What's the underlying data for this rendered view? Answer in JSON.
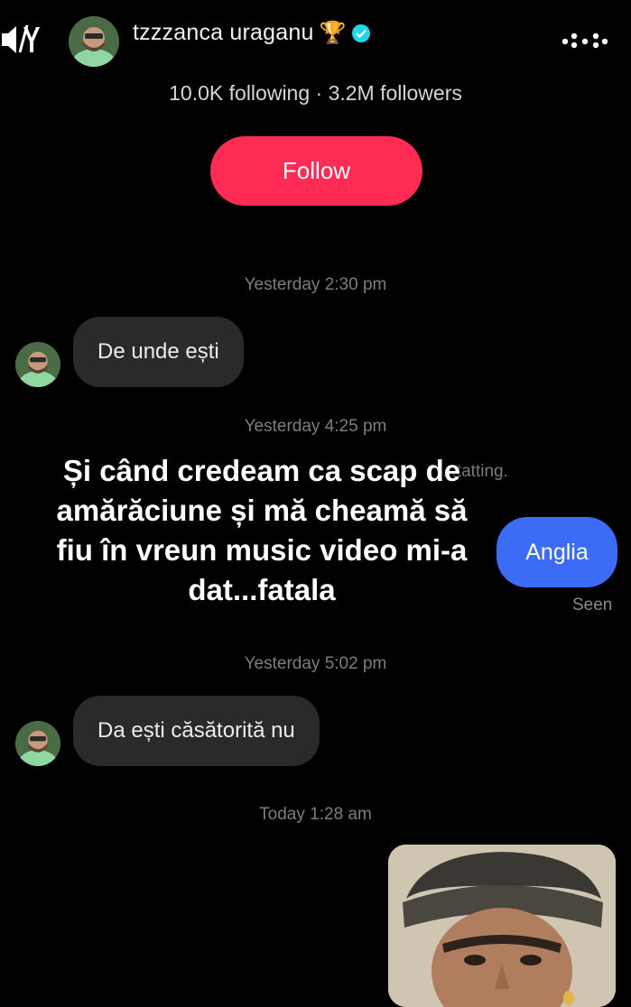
{
  "header": {
    "username": "tzzzanca uraganu",
    "trophy": "🏆",
    "stats": "10.0K following · 3.2M followers",
    "follow_label": "Follow",
    "icons": [
      "mute-icon",
      "trophy-icon",
      "verified-badge-icon",
      "more-icon"
    ]
  },
  "chat": {
    "items": [
      {
        "type": "timestamp",
        "text": "Yesterday 2:30 pm"
      },
      {
        "type": "incoming",
        "text": "De unde ești"
      },
      {
        "type": "timestamp",
        "text": "Yesterday 4:25 pm"
      },
      {
        "type": "system",
        "text": "...tatting."
      },
      {
        "type": "outgoing",
        "text": "Anglia"
      },
      {
        "type": "seen",
        "text": "Seen"
      },
      {
        "type": "timestamp",
        "text": "Yesterday 5:02 pm"
      },
      {
        "type": "incoming",
        "text": "Da ești căsătorită nu"
      },
      {
        "type": "timestamp",
        "text": "Today 1:28 am"
      }
    ]
  },
  "overlay_caption": {
    "lines": [
      "Și când credeam ca scap de",
      "amărăciune și mă cheamă să",
      "fiu în vreun music video mi-a",
      "dat...fatala"
    ]
  },
  "colors": {
    "background": "#000000",
    "follow_button": "#fe2c55",
    "outgoing_bubble": "#3c6bf6",
    "incoming_bubble": "#2a2a2a",
    "verified": "#20d5ec"
  }
}
